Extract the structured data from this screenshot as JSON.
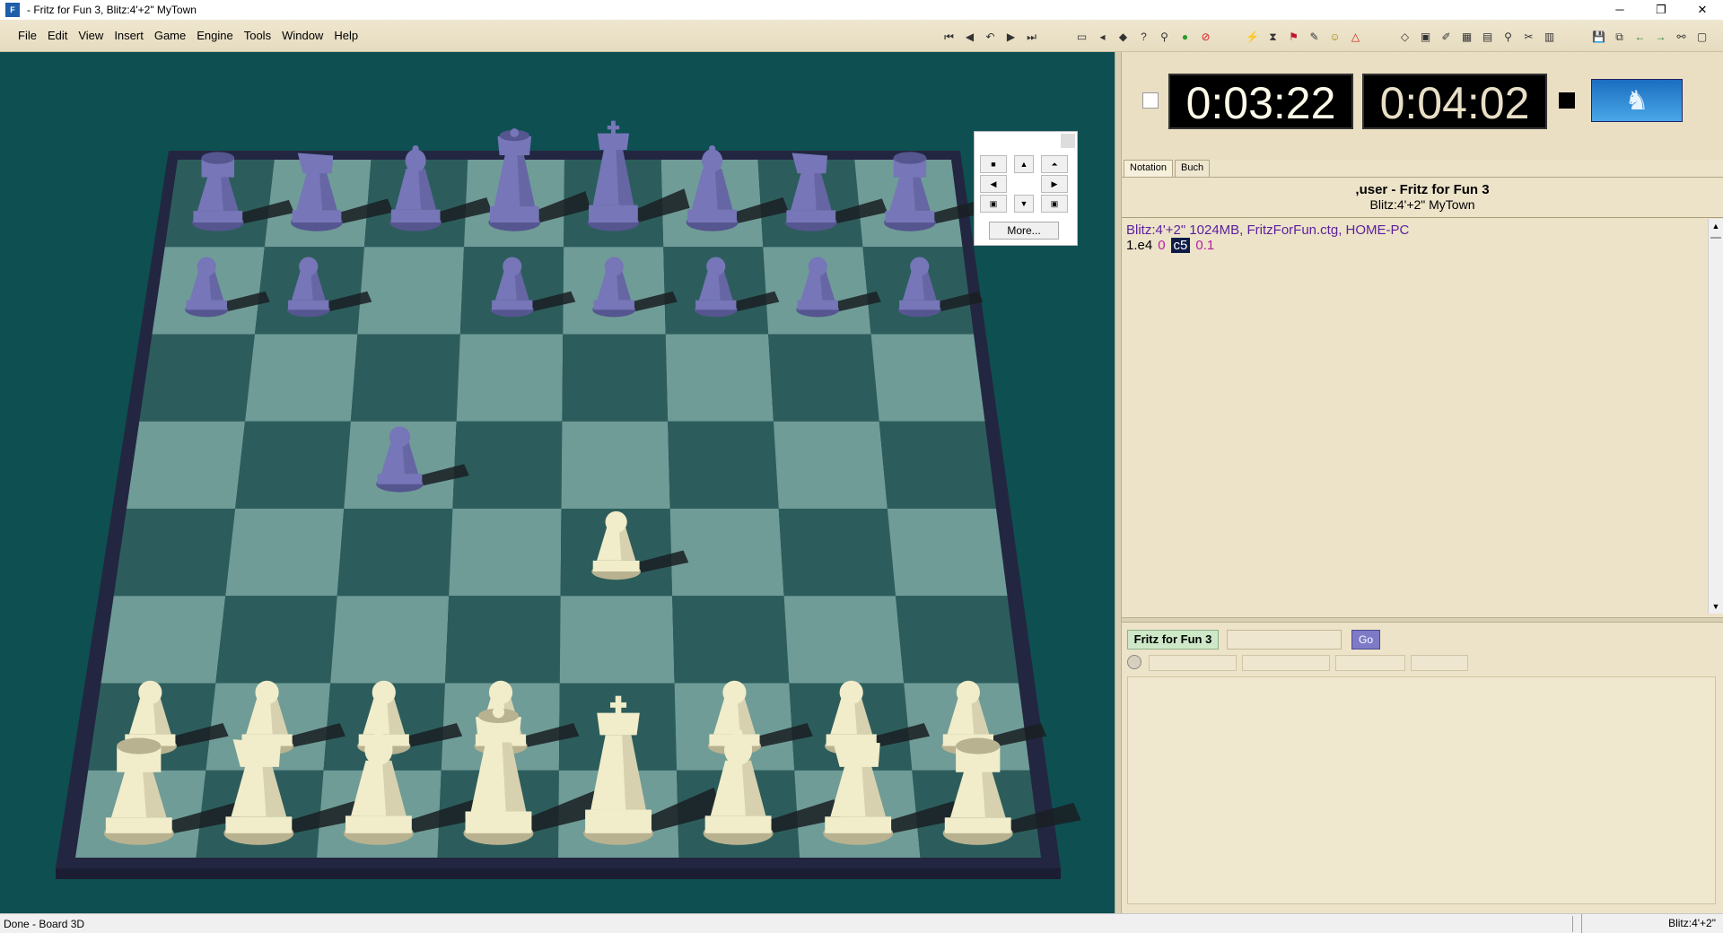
{
  "window": {
    "title": " - Fritz for Fun 3, Blitz:4'+2\" MyTown",
    "icon": "fritz-app-icon"
  },
  "window_controls": {
    "minimize": "─",
    "restore": "❐",
    "close": "✕"
  },
  "menu": [
    "File",
    "Edit",
    "View",
    "Insert",
    "Game",
    "Engine",
    "Tools",
    "Window",
    "Help"
  ],
  "toolbar_nav": [
    "⏮",
    "◀",
    "↶",
    "▶",
    "⏭"
  ],
  "toolbar_tools": [
    "▭",
    "◂",
    "◆",
    "?",
    "⚲",
    "●",
    "⊘"
  ],
  "toolbar_analysis": [
    "⚡",
    "⧗",
    "⚑",
    "✎",
    "☺",
    "△"
  ],
  "toolbar_misc": [
    "◇",
    "▣",
    "✐",
    "▦",
    "▤",
    "⚲",
    "✂",
    "▥"
  ],
  "toolbar_right": [
    "💾",
    "⧉",
    "←",
    "→",
    "⚯",
    "▢"
  ],
  "nav_panel": {
    "buttons": [
      "■",
      "▲",
      "⏶",
      "◀",
      "",
      "▶",
      "▣",
      "▼",
      "▣"
    ],
    "more_label": "More..."
  },
  "clocks": {
    "white": "0:03:22",
    "black": "0:04:02"
  },
  "logo": "♞",
  "tabs": [
    "Notation",
    "Buch"
  ],
  "game_header": {
    "players": ",user - Fritz for Fun 3",
    "event": "Blitz:4'+2\" MyTown"
  },
  "notation": {
    "info": "Blitz:4'+2\"  1024MB, FritzForFun.ctg, HOME-PC",
    "move_number": "1.e4",
    "move_time": "0",
    "current_move": "c5",
    "eval": "0.1"
  },
  "engine": {
    "name": "Fritz for Fun 3",
    "go_label": "Go"
  },
  "status": {
    "left": "Done - Board 3D",
    "right": "Blitz:4'+2\""
  },
  "colors": {
    "board_bg": "#0e4f52",
    "light_square": "#6f9c97",
    "dark_square": "#2c5d5c",
    "white_piece": "#f1ecc9",
    "black_piece": "#7676b8",
    "frame": "#232640"
  },
  "position": {
    "white": [
      {
        "sq": "a1",
        "p": "rook"
      },
      {
        "sq": "b1",
        "p": "knight"
      },
      {
        "sq": "c1",
        "p": "bishop"
      },
      {
        "sq": "d1",
        "p": "queen"
      },
      {
        "sq": "e1",
        "p": "king"
      },
      {
        "sq": "f1",
        "p": "bishop"
      },
      {
        "sq": "g1",
        "p": "knight"
      },
      {
        "sq": "h1",
        "p": "rook"
      },
      {
        "sq": "a2",
        "p": "pawn"
      },
      {
        "sq": "b2",
        "p": "pawn"
      },
      {
        "sq": "c2",
        "p": "pawn"
      },
      {
        "sq": "d2",
        "p": "pawn"
      },
      {
        "sq": "f2",
        "p": "pawn"
      },
      {
        "sq": "g2",
        "p": "pawn"
      },
      {
        "sq": "h2",
        "p": "pawn"
      },
      {
        "sq": "e4",
        "p": "pawn"
      }
    ],
    "black": [
      {
        "sq": "a8",
        "p": "rook"
      },
      {
        "sq": "b8",
        "p": "knight"
      },
      {
        "sq": "c8",
        "p": "bishop"
      },
      {
        "sq": "d8",
        "p": "queen"
      },
      {
        "sq": "e8",
        "p": "king"
      },
      {
        "sq": "f8",
        "p": "bishop"
      },
      {
        "sq": "g8",
        "p": "knight"
      },
      {
        "sq": "h8",
        "p": "rook"
      },
      {
        "sq": "a7",
        "p": "pawn"
      },
      {
        "sq": "b7",
        "p": "pawn"
      },
      {
        "sq": "d7",
        "p": "pawn"
      },
      {
        "sq": "e7",
        "p": "pawn"
      },
      {
        "sq": "f7",
        "p": "pawn"
      },
      {
        "sq": "g7",
        "p": "pawn"
      },
      {
        "sq": "h7",
        "p": "pawn"
      },
      {
        "sq": "c5",
        "p": "pawn"
      }
    ]
  }
}
